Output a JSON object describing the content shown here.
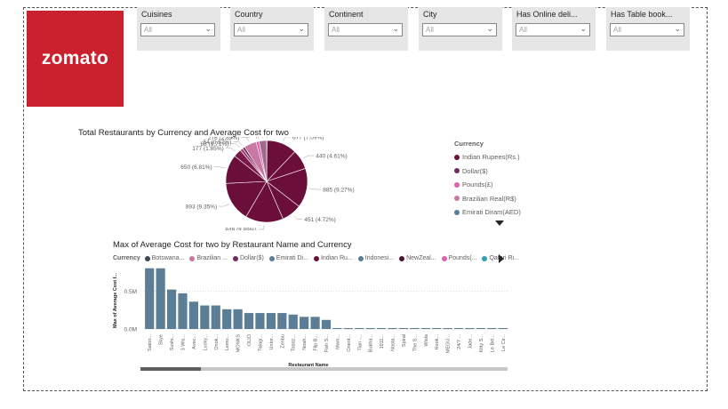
{
  "logo_text": "zomato",
  "colors": {
    "brand": "#cb202d",
    "bar": "#5b7d96",
    "pie_main": "#6b0f3a"
  },
  "slicers": [
    {
      "label": "Cuisines",
      "value": "All"
    },
    {
      "label": "Country",
      "value": "All"
    },
    {
      "label": "Continent",
      "value": "All"
    },
    {
      "label": "City",
      "value": "All"
    },
    {
      "label": "Has Online deli...",
      "value": "All"
    },
    {
      "label": "Has Table book...",
      "value": "All"
    }
  ],
  "pie": {
    "title": "Total Restaurants by Currency and Average Cost for two",
    "legend_title": "Currency",
    "legend": [
      {
        "name": "Indian Rupees(Rs.)",
        "color": "#6b0f3a"
      },
      {
        "name": "Dollar($)",
        "color": "#6e2b63"
      },
      {
        "name": "Pounds(£)",
        "color": "#e05fae"
      },
      {
        "name": "Brazilian Real(R$)",
        "color": "#c879a3"
      },
      {
        "name": "Emirati Diram(AED)",
        "color": "#5b7d96"
      }
    ]
  },
  "bar": {
    "title": "Max of Average Cost for two by Restaurant Name and Currency",
    "legend_title": "Currency",
    "legend": [
      {
        "name": "Botswana...",
        "color": "#3b4a59"
      },
      {
        "name": "Brazilian ...",
        "color": "#c879a3"
      },
      {
        "name": "Dollar($)",
        "color": "#6e2b63"
      },
      {
        "name": "Emirati Di...",
        "color": "#5b7d96"
      },
      {
        "name": "Indian Ru...",
        "color": "#6b0f3a"
      },
      {
        "name": "Indonesi...",
        "color": "#5b7d96"
      },
      {
        "name": "NewZeal...",
        "color": "#4a1530"
      },
      {
        "name": "Pounds(...",
        "color": "#e05fae"
      },
      {
        "name": "Qatari Ri...",
        "color": "#2aa3b0"
      }
    ]
  },
  "chart_data": [
    {
      "type": "pie",
      "title": "Total Restaurants by Currency and Average Cost for two",
      "slices": [
        {
          "label": "9 (0.09%)",
          "value": 9
        },
        {
          "label": "677 (7.09%)",
          "value": 677
        },
        {
          "label": "440 (4.61%)",
          "value": 440
        },
        {
          "label": "885 (9.27%)",
          "value": 885
        },
        {
          "label": "451 (4.72%)",
          "value": 451
        },
        {
          "label": "849 (8.89%)",
          "value": 849
        },
        {
          "label": "893 (9.35%)",
          "value": 893
        },
        {
          "label": "650 (6.81%)",
          "value": 650
        },
        {
          "label": "177 (1.85%)",
          "value": 177
        },
        {
          "label": "68 (0.71%)",
          "value": 68
        },
        {
          "label": "54 (0.57%)",
          "value": 54
        },
        {
          "label": "276 (2.89%)",
          "value": 276
        },
        {
          "label": "67 (0.7%)",
          "value": 67
        },
        {
          "label": "3 (0.03%)",
          "value": 3
        },
        {
          "label": "168 (1.76%)",
          "value": 168
        }
      ]
    },
    {
      "type": "bar",
      "title": "Max of Average Cost for two by Restaurant Name and Currency",
      "xlabel": "Restaurant Name",
      "ylabel": "Max of Average Cost f...",
      "yticks": [
        "0.0M",
        "0.5M"
      ],
      "ylim": [
        0,
        0.75
      ],
      "categories": [
        "Satoo...",
        "Skye",
        "Sushi...",
        "3 Wis...",
        "Avec...",
        "Lucky...",
        "Onok...",
        "Lemo...",
        "MONKS",
        "OLIO",
        "Talagi...",
        "Unior...",
        "Zenbu",
        "Toddz...",
        "Noah...",
        "Flip B...",
        "Fish S...",
        "Mam...",
        "Orient...",
        "Tian -...",
        "Bukha...",
        "1911...",
        "Nosta...",
        "Spiral",
        "The S...",
        "Wisla",
        "Hook...",
        "MEGU...",
        "24/7 ...",
        "Jade...",
        "Kitty S...",
        "Le Bel...",
        "Le Cir..."
      ],
      "values": [
        0.8,
        0.8,
        0.52,
        0.47,
        0.36,
        0.31,
        0.31,
        0.26,
        0.26,
        0.21,
        0.21,
        0.21,
        0.21,
        0.19,
        0.16,
        0.16,
        0.12,
        0.012,
        0.012,
        0.012,
        0.012,
        0.012,
        0.012,
        0.012,
        0.012,
        0.012,
        0.012,
        0.012,
        0.012,
        0.012,
        0.012,
        0.012,
        0.012
      ]
    }
  ]
}
